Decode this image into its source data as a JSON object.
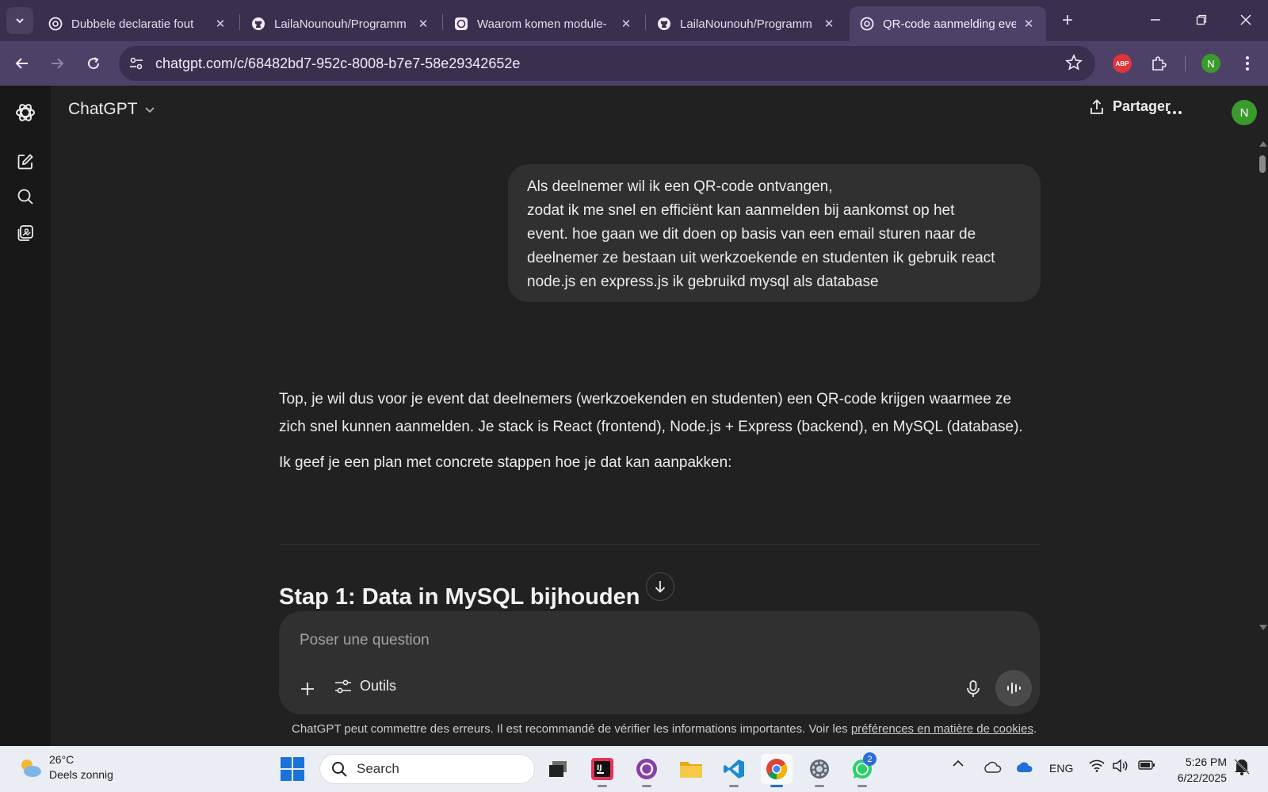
{
  "browser": {
    "tabs": [
      {
        "title": "Dubbele declaratie fout",
        "icon": "chatgpt-icon"
      },
      {
        "title": "LailaNounouh/Programm",
        "icon": "github-icon"
      },
      {
        "title": "Waarom komen module-",
        "icon": "chatgpt-icon"
      },
      {
        "title": "LailaNounouh/Programm",
        "icon": "github-icon"
      },
      {
        "title": "QR-code aanmelding eve",
        "icon": "chatgpt-icon",
        "active": true
      }
    ],
    "url": "chatgpt.com/c/68482bd7-952c-8008-b7e7-58e29342652e",
    "extensions": {
      "abp_label": "ABP",
      "profile_initial": "N"
    }
  },
  "app": {
    "model_name": "ChatGPT",
    "share_label": "Partager",
    "user_initial": "N",
    "sidebar_icons": [
      "chatgpt-logo-icon",
      "new-chat-icon",
      "search-icon",
      "library-icon"
    ]
  },
  "conversation": {
    "user_message_lines": [
      "Als deelnemer wil ik een QR-code ontvangen,",
      "zodat ik me snel en efficiënt kan aanmelden bij aankomst op het",
      "event. hoe gaan we dit doen op basis van een email sturen naar de",
      "deelnemer ze bestaan uit werkzoekende en studenten ik gebruik react",
      "node.js en express.js ik gebruikd mysql als database"
    ],
    "assistant_paragraphs": [
      "Top, je wil dus voor je event dat deelnemers (werkzoekenden en studenten) een QR-code krijgen waarmee ze zich snel kunnen aanmelden. Je stack is React (frontend), Node.js + Express (backend), en MySQL (database).",
      "Ik geef je een plan met concrete stappen hoe je dat kan aanpakken:"
    ],
    "step_heading": "Stap 1: Data in MySQL bijhouden"
  },
  "composer": {
    "placeholder": "Poser une question",
    "tools_label": "Outils"
  },
  "disclaimer": {
    "text": "ChatGPT peut commettre des erreurs. Il est recommandé de vérifier les informations importantes. Voir les ",
    "link": "préférences en matière de cookies",
    "end": "."
  },
  "taskbar": {
    "weather_temp": "26°C",
    "weather_desc": "Deels zonnig",
    "search_label": "Search",
    "whatsapp_badge": "2",
    "language": "ENG",
    "time": "5:26 PM",
    "date": "6/22/2025"
  },
  "colors": {
    "tabstrip": "#3a2f4e",
    "toolbar": "#4e4168",
    "app_bg": "#212121",
    "sidebar_bg": "#181818",
    "bubble": "#303030",
    "avatar": "#3a9a2e"
  }
}
